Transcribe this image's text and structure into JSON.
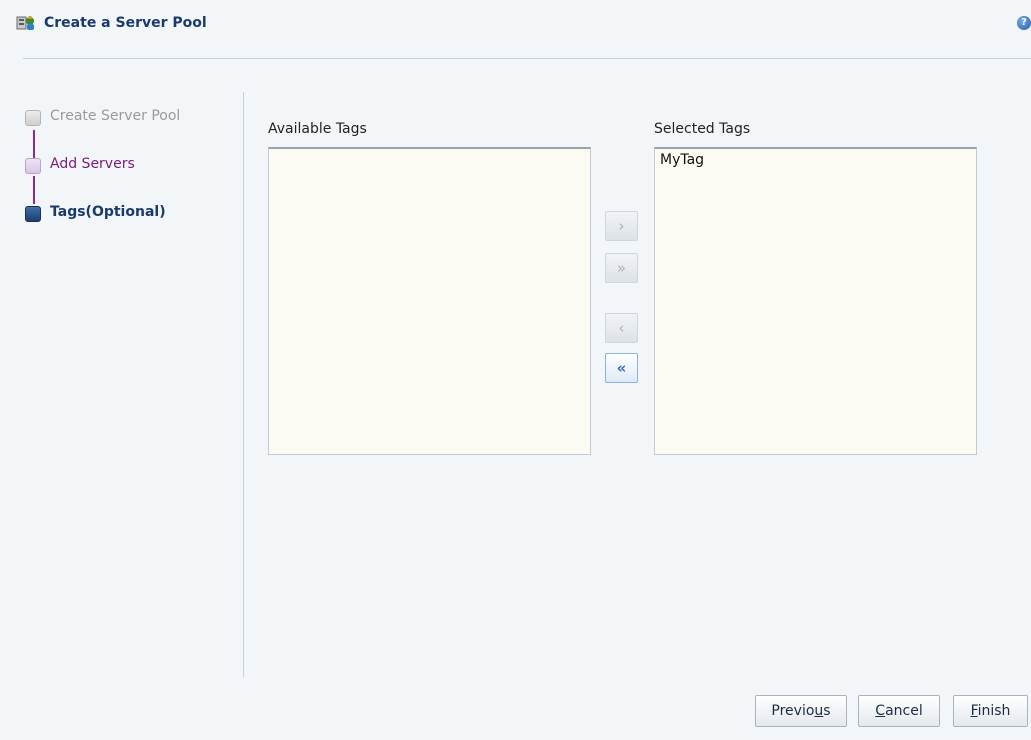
{
  "dialog": {
    "title": "Create a Server Pool",
    "help_icon": "help-icon",
    "title_icon": "server-pool-icon"
  },
  "train": {
    "stops": [
      {
        "label": "Create Server Pool",
        "state": "visited"
      },
      {
        "label": "Add Servers",
        "state": "next"
      },
      {
        "label": "Tags(Optional)",
        "state": "current"
      }
    ]
  },
  "shuttle": {
    "available_label": "Available Tags",
    "selected_label": "Selected Tags",
    "available_items": [],
    "selected_items": [
      "MyTag"
    ],
    "buttons": {
      "move": "›",
      "move_all": "»",
      "remove": "‹",
      "remove_all": "«"
    }
  },
  "footer": {
    "previous_pre": "Previo",
    "previous_key": "u",
    "previous_post": "s",
    "cancel_key": "C",
    "cancel_post": "ancel",
    "finish_key": "F",
    "finish_post": "inish"
  },
  "colors": {
    "title": "#1a3a6e",
    "train_line": "#8a2c8a",
    "list_background": "#fbfbf3",
    "active_arrow": "#2f6ec8"
  }
}
